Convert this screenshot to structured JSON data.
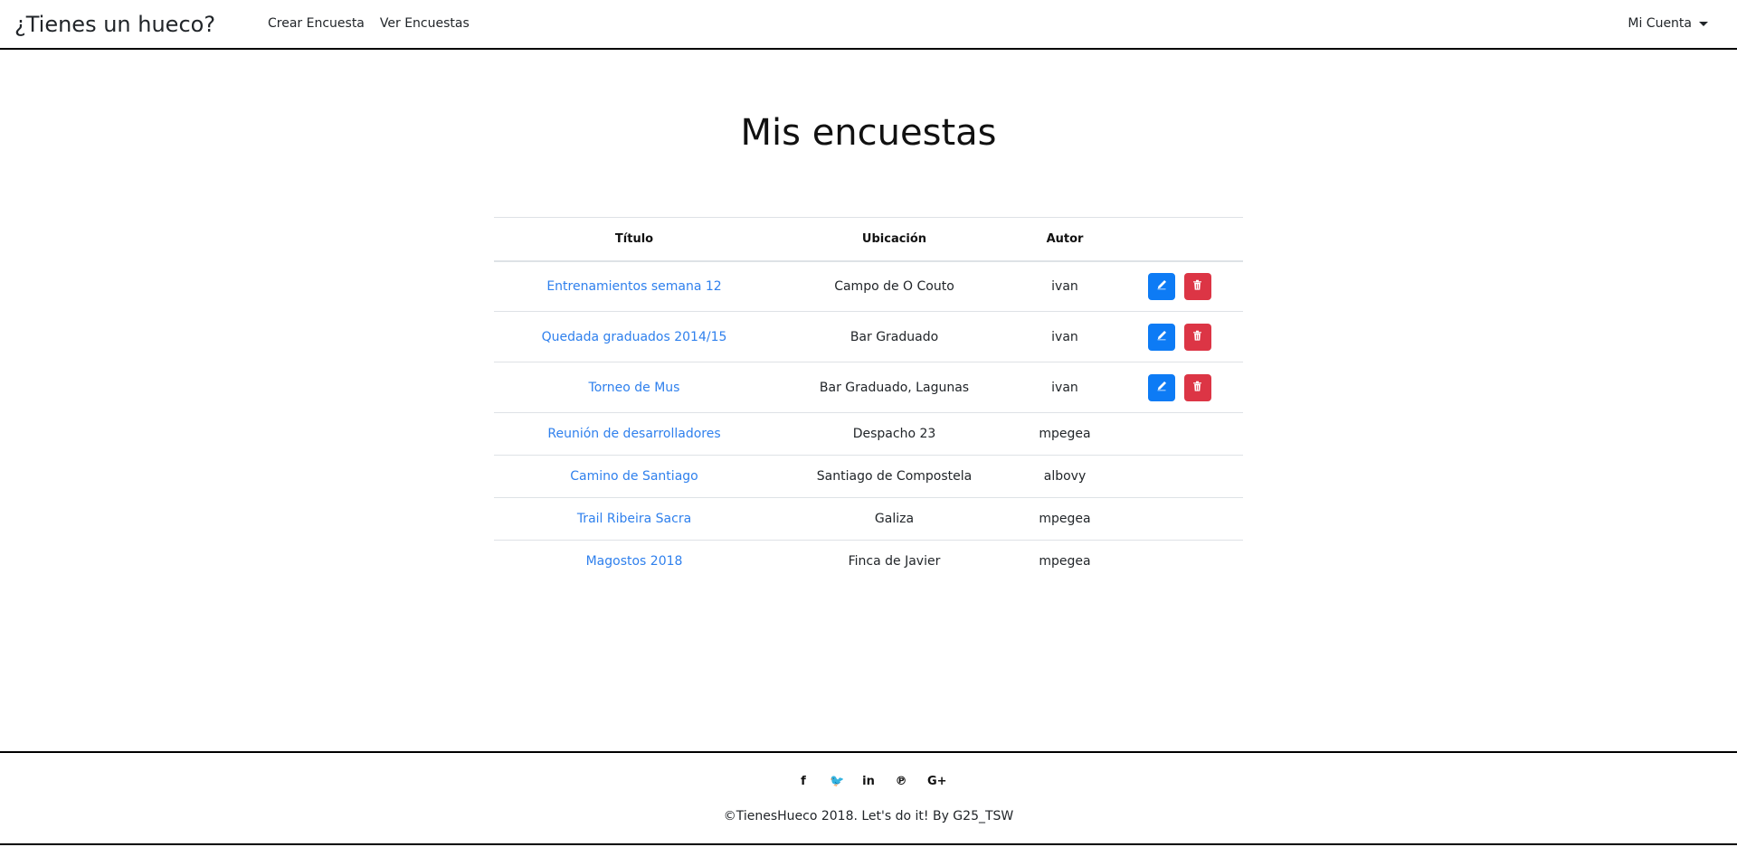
{
  "navbar": {
    "brand": "¿Tienes un hueco?",
    "links": [
      "Crear Encuesta",
      "Ver Encuestas"
    ],
    "account": "Mi Cuenta"
  },
  "page": {
    "title": "Mis encuestas"
  },
  "table": {
    "headers": [
      "Título",
      "Ubicación",
      "Autor"
    ],
    "rows": [
      {
        "title": "Entrenamientos semana 12",
        "location": "Campo de O Couto",
        "author": "ivan",
        "actions": true
      },
      {
        "title": "Quedada graduados 2014/15",
        "location": "Bar Graduado",
        "author": "ivan",
        "actions": true
      },
      {
        "title": "Torneo de Mus",
        "location": "Bar Graduado, Lagunas",
        "author": "ivan",
        "actions": true
      },
      {
        "title": "Reunión de desarrolladores",
        "location": "Despacho 23",
        "author": "mpegea",
        "actions": false
      },
      {
        "title": "Camino de Santiago",
        "location": "Santiago de Compostela",
        "author": "albovy",
        "actions": false
      },
      {
        "title": "Trail Ribeira Sacra",
        "location": "Galiza",
        "author": "mpegea",
        "actions": false
      },
      {
        "title": "Magostos 2018",
        "location": "Finca de Javier",
        "author": "mpegea",
        "actions": false
      }
    ]
  },
  "footer": {
    "social": [
      {
        "icon": "facebook-icon",
        "glyph": "f"
      },
      {
        "icon": "twitter-icon",
        "glyph": "🐦"
      },
      {
        "icon": "linkedin-icon",
        "glyph": "in"
      },
      {
        "icon": "pinterest-icon",
        "glyph": "℗"
      },
      {
        "icon": "google-plus-icon",
        "glyph": "G+"
      }
    ],
    "copyright": "©TienesHueco 2018. Let's do it! By G25_TSW"
  },
  "colors": {
    "link": "#2f80ed",
    "edit": "#0d7bf5",
    "delete": "#dc3545"
  }
}
